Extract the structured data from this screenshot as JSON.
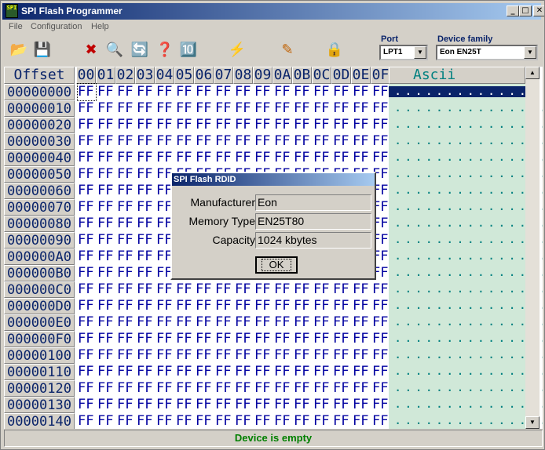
{
  "window": {
    "title": "SPI Flash Programmer",
    "icon_text": "SPI"
  },
  "title_buttons": {
    "minimize": "_",
    "maximize": "□",
    "close": "✕"
  },
  "menu": {
    "items": [
      "File",
      "Configuration",
      "Help"
    ]
  },
  "toolbar": {
    "tools": [
      {
        "icon": "open-file-icon",
        "glyph": "📂"
      },
      {
        "icon": "save-file-icon",
        "glyph": "💾"
      },
      {
        "icon": "erase-chip-icon",
        "glyph": "✖"
      },
      {
        "icon": "read-chip-icon",
        "glyph": "🔍"
      },
      {
        "icon": "write-chip-icon",
        "glyph": "🔄"
      },
      {
        "icon": "verify-chip-icon",
        "glyph": "❓"
      },
      {
        "icon": "blank-check-icon",
        "glyph": "🔟"
      },
      {
        "icon": "auto-program-icon",
        "glyph": "⚡"
      },
      {
        "icon": "chip-id-icon",
        "glyph": "✎"
      },
      {
        "icon": "lock-icon",
        "glyph": "🔒"
      }
    ],
    "port": {
      "label": "Port",
      "value": "LPT1"
    },
    "device_family": {
      "label": "Device family",
      "value": "Eon EN25T"
    }
  },
  "hex_view": {
    "offset_header": "Offset",
    "column_headers": [
      "00",
      "01",
      "02",
      "03",
      "04",
      "05",
      "06",
      "07",
      "08",
      "09",
      "0A",
      "0B",
      "0C",
      "0D",
      "0E",
      "0F"
    ],
    "ascii_header": "Ascii",
    "offsets": [
      "00000000",
      "00000010",
      "00000020",
      "00000030",
      "00000040",
      "00000050",
      "00000060",
      "00000070",
      "00000080",
      "00000090",
      "000000A0",
      "000000B0",
      "000000C0",
      "000000D0",
      "000000E0",
      "000000F0",
      "00000100",
      "00000110",
      "00000120",
      "00000130",
      "00000140"
    ],
    "byte_value": "FF",
    "ascii_value": "................"
  },
  "status": {
    "text": "Device is empty"
  },
  "dialog": {
    "title": "SPI Flash RDID",
    "fields": [
      {
        "label": "Manufacturer",
        "value": "Eon"
      },
      {
        "label": "Memory Type",
        "value": "EN25T80"
      },
      {
        "label": "Capacity",
        "value": "1024 kbytes"
      }
    ],
    "ok_label": "OK"
  },
  "colors": {
    "title_bar": "#0a246a",
    "status_text": "#008000",
    "hex_text": "#0000a0",
    "ascii_bg": "#d0e8d8"
  }
}
